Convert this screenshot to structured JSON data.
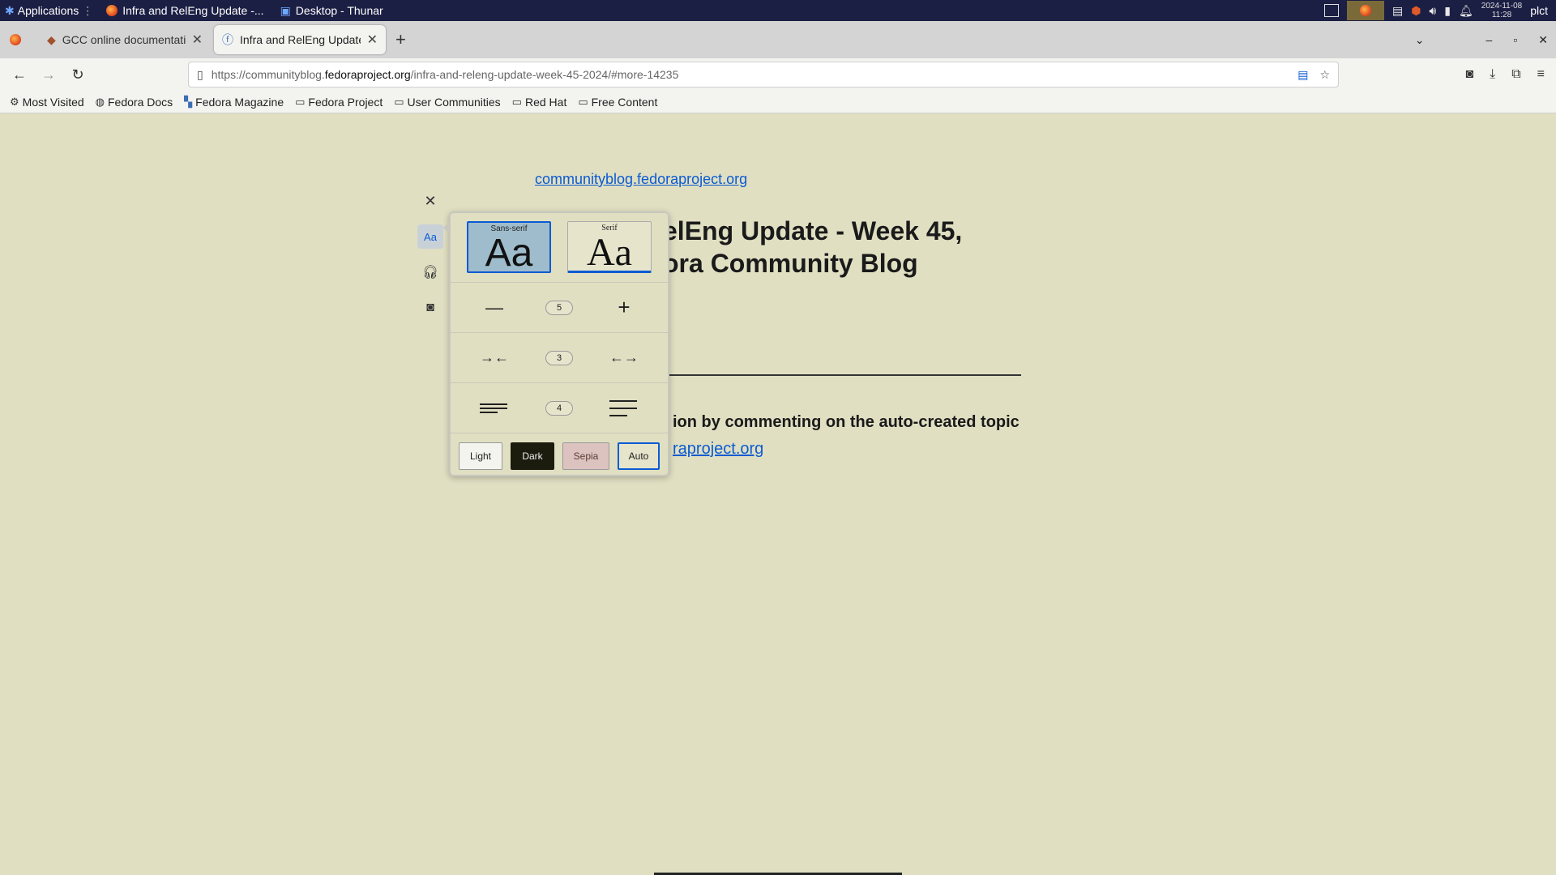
{
  "taskbar": {
    "applications_label": "Applications",
    "tasks": [
      {
        "label": "Infra and RelEng Update -..."
      },
      {
        "label": "Desktop - Thunar"
      }
    ],
    "clock_date": "2024-11-08",
    "clock_time": "11:28",
    "user": "plct"
  },
  "tabs": [
    {
      "title": "GCC online documentation",
      "active": false
    },
    {
      "title": "Infra and RelEng Update -",
      "active": true
    }
  ],
  "navbar": {
    "url_prefix": "https://communityblog.",
    "url_domain": "fedoraproject.org",
    "url_suffix": "/infra-and-releng-update-week-45-2024/#more-14235"
  },
  "bookmarks": [
    {
      "label": "Most Visited",
      "icon": "gear-icon"
    },
    {
      "label": "Fedora Docs",
      "icon": "globe-icon"
    },
    {
      "label": "Fedora Magazine",
      "icon": "bookmark-icon"
    },
    {
      "label": "Fedora Project",
      "icon": "folder-icon"
    },
    {
      "label": "User Communities",
      "icon": "folder-icon"
    },
    {
      "label": "Red Hat",
      "icon": "folder-icon"
    },
    {
      "label": "Free Content",
      "icon": "folder-icon"
    }
  ],
  "article": {
    "site_link": "communityblog.fedoraproject.org",
    "headline_line1": "elEng Update - Week 45,",
    "headline_line2": "ora Community Blog",
    "body_line1": "ion by commenting on the auto-created topic",
    "body_link": "raproject.org"
  },
  "reader": {
    "type_controls_label": "Aa",
    "font_sans_label": "Sans-serif",
    "font_sans_sample": "Aa",
    "font_serif_label": "Serif",
    "font_serif_sample": "Aa",
    "font_size_value": "5",
    "content_width_value": "3",
    "line_height_value": "4",
    "themes": {
      "light": "Light",
      "dark": "Dark",
      "sepia": "Sepia",
      "auto": "Auto"
    },
    "selected_font": "Sans-serif",
    "selected_theme": "Auto"
  },
  "colors": {
    "page_background": "#e0dfc2",
    "link": "#0b5bd3",
    "taskbar": "#1c1f44"
  }
}
